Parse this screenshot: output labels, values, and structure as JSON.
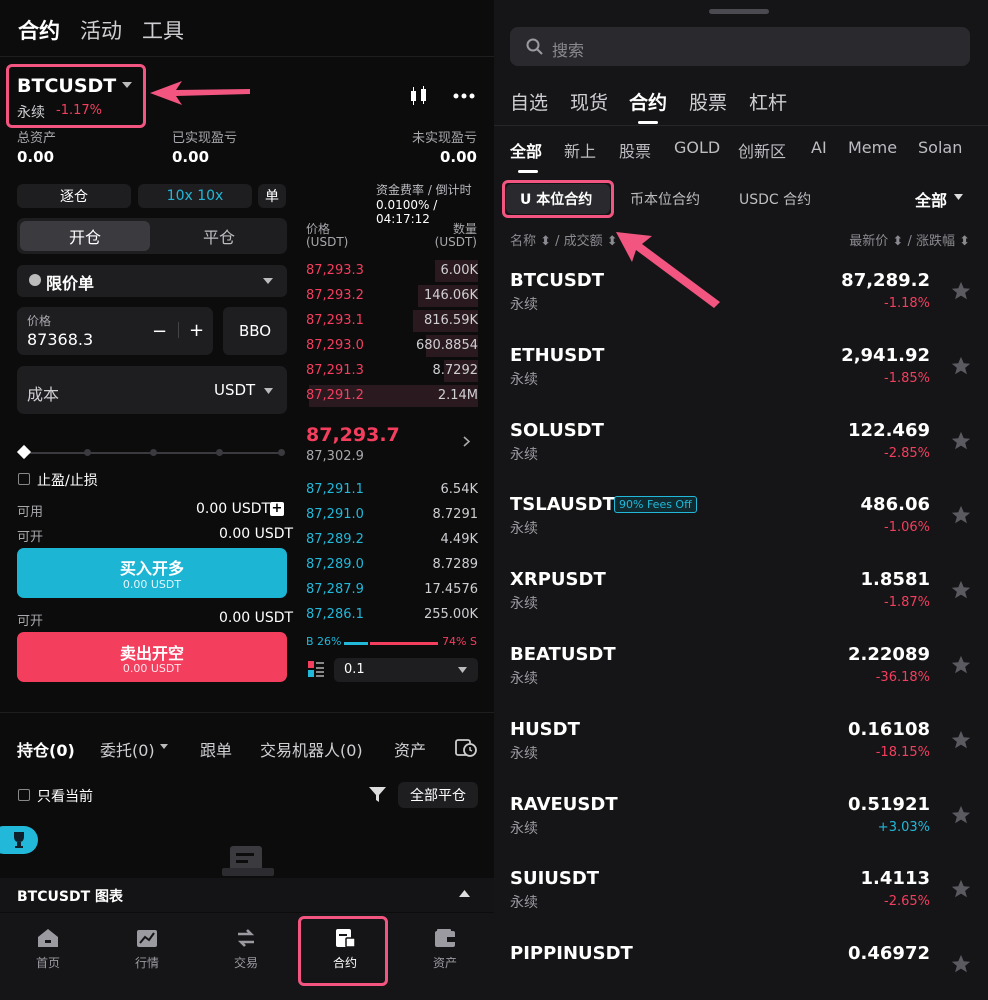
{
  "left": {
    "topnav": [
      "合约",
      "活动",
      "工具"
    ],
    "symbol": {
      "name": "BTCUSDT",
      "type": "永续",
      "change": "-1.17%"
    },
    "balances": [
      {
        "label": "总资产",
        "value": "0.00"
      },
      {
        "label": "已实现盈亏",
        "value": "0.00"
      },
      {
        "label": "未实现盈亏",
        "value": "0.00"
      }
    ],
    "mode": {
      "margin": "逐仓",
      "leverage": "10x 10x",
      "single": "单"
    },
    "funding": {
      "label": "资金费率 / 倒计时",
      "value": "0.0100% / 04:17:12"
    },
    "open_close": {
      "open": "开仓",
      "close": "平仓"
    },
    "order_type": "限价单",
    "price": {
      "label": "价格",
      "value": "87368.3",
      "minus": "−",
      "plus": "+",
      "bbo": "BBO"
    },
    "cost": {
      "label": "成本",
      "unit": "USDT"
    },
    "tpsl": "止盈/止损",
    "available": {
      "label": "可用",
      "value": "0.00 USDT"
    },
    "openable_long": {
      "label": "可开",
      "value": "0.00 USDT"
    },
    "buy": {
      "label": "买入开多",
      "sub": "0.00 USDT"
    },
    "openable_short": {
      "label": "可开",
      "value": "0.00 USDT"
    },
    "sell": {
      "label": "卖出开空",
      "sub": "0.00 USDT"
    },
    "orderbook": {
      "price_header": "价格",
      "price_unit": "(USDT)",
      "qty_header": "数量",
      "qty_unit": "(USDT)",
      "asks": [
        {
          "price": "87,293.3",
          "qty": "6.00K",
          "depth": 0.25
        },
        {
          "price": "87,293.2",
          "qty": "146.06K",
          "depth": 0.35
        },
        {
          "price": "87,293.1",
          "qty": "816.59K",
          "depth": 0.38
        },
        {
          "price": "87,293.0",
          "qty": "680.8854",
          "depth": 0.3
        },
        {
          "price": "87,291.3",
          "qty": "8.7292",
          "depth": 0.2
        },
        {
          "price": "87,291.2",
          "qty": "2.14M",
          "depth": 0.98
        }
      ],
      "last_price": "87,293.7",
      "mark_price": "87,302.9",
      "bids": [
        {
          "price": "87,291.1",
          "qty": "6.54K"
        },
        {
          "price": "87,291.0",
          "qty": "8.7291"
        },
        {
          "price": "87,289.2",
          "qty": "4.49K"
        },
        {
          "price": "87,289.0",
          "qty": "8.7289"
        },
        {
          "price": "87,287.9",
          "qty": "17.4576"
        },
        {
          "price": "87,286.1",
          "qty": "255.00K"
        }
      ],
      "buy_pct_label": "B 26%",
      "sell_pct_label": "74% S",
      "buy_ratio": 0.26,
      "precision": "0.1"
    },
    "bottom_tabs": [
      "持仓(0)",
      "委托(0)",
      "跟单",
      "交易机器人(0)",
      "资产"
    ],
    "only_current": "只看当前",
    "close_all": "全部平仓",
    "chart_bar": "BTCUSDT 图表",
    "tabbar": [
      "首页",
      "行情",
      "交易",
      "合约",
      "资产"
    ]
  },
  "right": {
    "search_placeholder": "搜索",
    "cat1": [
      "自选",
      "现货",
      "合约",
      "股票",
      "杠杆"
    ],
    "cat2": [
      "全部",
      "新上",
      "股票",
      "GOLD",
      "创新区",
      "AI",
      "Meme",
      "Solan"
    ],
    "cat3": [
      "U 本位合约",
      "币本位合约",
      "USDC 合约"
    ],
    "filter_all": "全部",
    "sort_left": "名称 ⬍ / 成交额 ⬍",
    "sort_right": "最新价 ⬍ / 涨跌幅 ⬍",
    "badge": "90% Fees Off",
    "rows": [
      {
        "sym": "BTCUSDT",
        "sub": "永续",
        "price": "87,289.2",
        "chg": "-1.18%",
        "dir": "down"
      },
      {
        "sym": "ETHUSDT",
        "sub": "永续",
        "price": "2,941.92",
        "chg": "-1.85%",
        "dir": "down"
      },
      {
        "sym": "SOLUSDT",
        "sub": "永续",
        "price": "122.469",
        "chg": "-2.85%",
        "dir": "down"
      },
      {
        "sym": "TSLAUSDT",
        "sub": "永续",
        "price": "486.06",
        "chg": "-1.06%",
        "dir": "down"
      },
      {
        "sym": "XRPUSDT",
        "sub": "永续",
        "price": "1.8581",
        "chg": "-1.87%",
        "dir": "down"
      },
      {
        "sym": "BEATUSDT",
        "sub": "永续",
        "price": "2.22089",
        "chg": "-36.18%",
        "dir": "down"
      },
      {
        "sym": "HUSDT",
        "sub": "永续",
        "price": "0.16108",
        "chg": "-18.15%",
        "dir": "down"
      },
      {
        "sym": "RAVEUSDT",
        "sub": "永续",
        "price": "0.51921",
        "chg": "+3.03%",
        "dir": "up"
      },
      {
        "sym": "SUIUSDT",
        "sub": "永续",
        "price": "1.4113",
        "chg": "-2.65%",
        "dir": "down"
      },
      {
        "sym": "PIPPINUSDT",
        "sub": "",
        "price": "0.46972",
        "chg": "",
        "dir": "down"
      }
    ]
  },
  "colors": {
    "accent_red": "#f43e5e",
    "accent_blue": "#22b8d9",
    "highlight": "#f2557f"
  }
}
